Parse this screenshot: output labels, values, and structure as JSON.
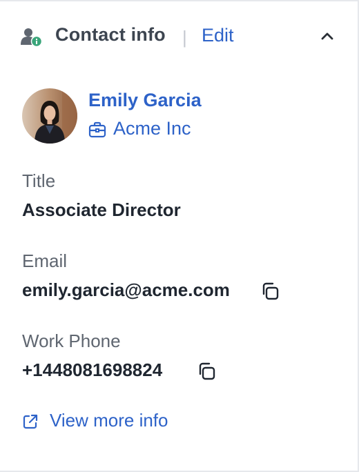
{
  "header": {
    "title": "Contact info",
    "separator": "|",
    "edit_label": "Edit",
    "icon": "user-info-icon",
    "collapse_icon": "chevron-up-icon"
  },
  "contact": {
    "name": "Emily Garcia",
    "company": "Acme Inc",
    "company_icon": "briefcase-icon"
  },
  "fields": {
    "title": {
      "label": "Title",
      "value": "Associate Director"
    },
    "email": {
      "label": "Email",
      "value": "emily.garcia@acme.com"
    },
    "phone": {
      "label": "Work Phone",
      "value": "+1448081698824"
    }
  },
  "footer": {
    "view_more_label": "View more info",
    "icon": "external-link-icon"
  },
  "colors": {
    "link": "#2d62c8",
    "heading": "#3d4550",
    "label": "#5f6670",
    "value": "#1f2630",
    "badge": "#3aa57a",
    "border": "#e6e8ec"
  }
}
